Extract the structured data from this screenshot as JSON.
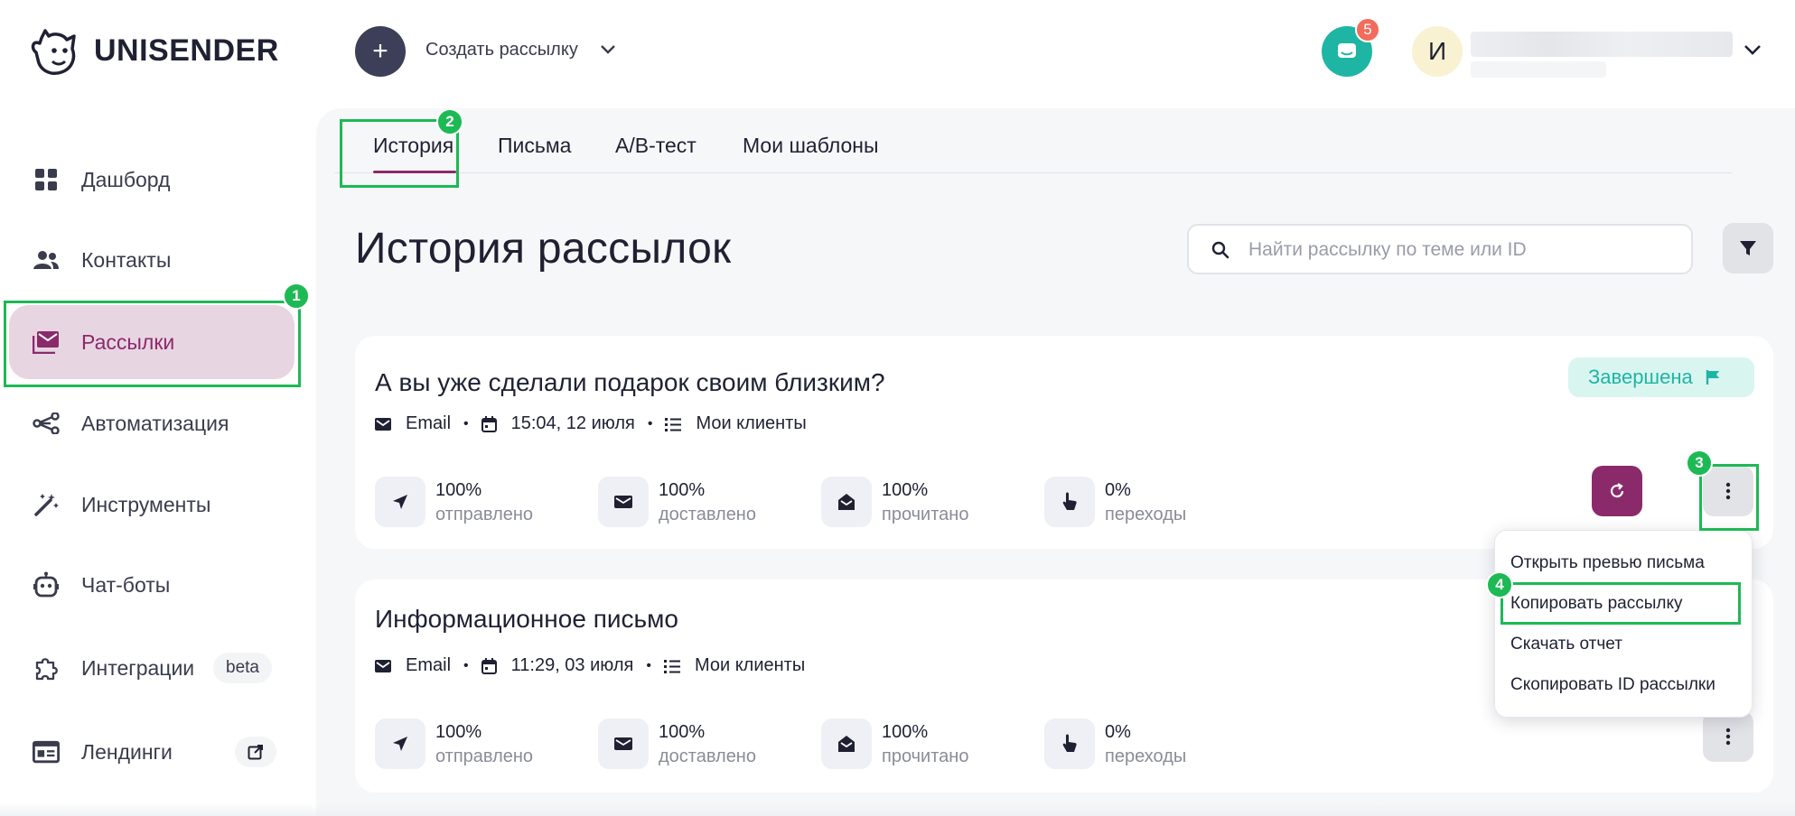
{
  "brand": {
    "name": "UNISENDER"
  },
  "header": {
    "create_label": "Создать рассылку",
    "create_plus": "+",
    "notifications_count": "5",
    "avatar_letter": "И"
  },
  "sidebar": {
    "items": [
      {
        "label": "Дашборд",
        "icon": "dashboard-icon"
      },
      {
        "label": "Контакты",
        "icon": "contacts-icon"
      },
      {
        "label": "Рассылки",
        "icon": "mail-icon"
      },
      {
        "label": "Автоматизация",
        "icon": "automation-icon"
      },
      {
        "label": "Инструменты",
        "icon": "magic-wand-icon"
      },
      {
        "label": "Чат-боты",
        "icon": "bot-icon"
      },
      {
        "label": "Интеграции",
        "icon": "puzzle-icon",
        "badge": "beta"
      },
      {
        "label": "Лендинги",
        "icon": "landing-icon"
      }
    ]
  },
  "tabs": [
    "История",
    "Письма",
    "A/B-тест",
    "Мои шаблоны"
  ],
  "page": {
    "title": "История рассылок",
    "search_placeholder": "Найти рассылку по теме или ID"
  },
  "campaigns": [
    {
      "title": "А вы уже сделали подарок своим близким?",
      "channel": "Email",
      "datetime": "15:04, 12 июля",
      "list": "Мои клиенты",
      "status": "Завершена",
      "stats": [
        {
          "value": "100%",
          "label": "отправлено"
        },
        {
          "value": "100%",
          "label": "доставлено"
        },
        {
          "value": "100%",
          "label": "прочитано"
        },
        {
          "value": "0%",
          "label": "переходы"
        }
      ]
    },
    {
      "title": "Информационное письмо",
      "channel": "Email",
      "datetime": "11:29, 03 июля",
      "list": "Мои клиенты",
      "stats": [
        {
          "value": "100%",
          "label": "отправлено"
        },
        {
          "value": "100%",
          "label": "доставлено"
        },
        {
          "value": "100%",
          "label": "прочитано"
        },
        {
          "value": "0%",
          "label": "переходы"
        }
      ]
    }
  ],
  "context_menu": [
    "Открыть превью письма",
    "Копировать рассылку",
    "Скачать отчет",
    "Скопировать ID рассылки"
  ],
  "callouts": [
    "1",
    "2",
    "3",
    "4"
  ],
  "colors": {
    "accent": "#8b2a6b",
    "highlight": "#1db954",
    "teal": "#1fb5a5"
  }
}
